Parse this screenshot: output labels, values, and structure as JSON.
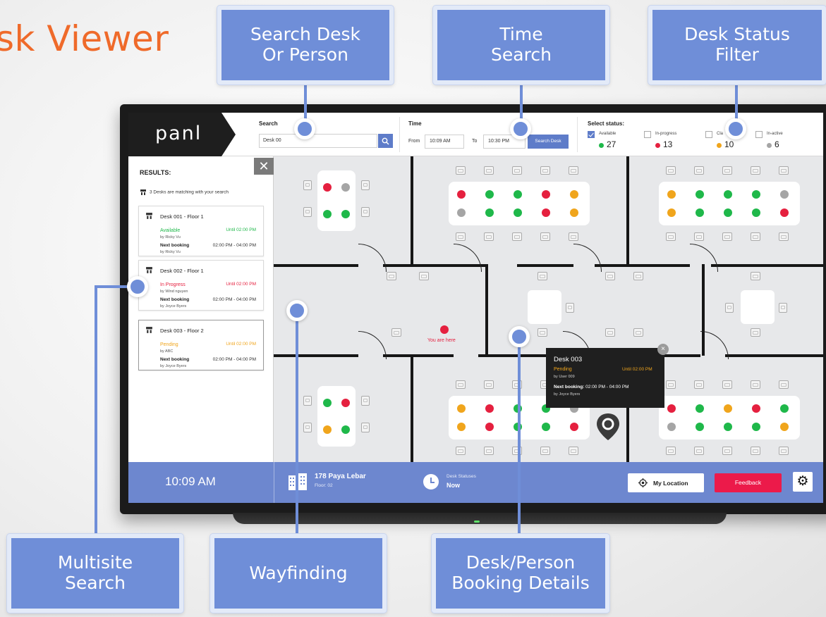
{
  "heading": "sk Viewer",
  "callouts": {
    "search": "Search Desk\nOr Person",
    "time": "Time\nSearch",
    "status_filter": "Desk Status\nFilter",
    "multisite": "Multisite\nSearch",
    "wayfinding": "Wayfinding",
    "booking_details": "Desk/Person\nBooking Details"
  },
  "app": {
    "logo": "panl",
    "search": {
      "label": "Search",
      "value": "Desk 00"
    },
    "time": {
      "label": "Time",
      "from_label": "From",
      "from_value": "10:09 AM",
      "to_label": "To",
      "to_value": "10:30 PM",
      "button": "Search Desk"
    },
    "status": {
      "label": "Select status:",
      "options": [
        {
          "name": "Available",
          "count": "27",
          "color": "#1fb84a",
          "checked": true
        },
        {
          "name": "In-progress",
          "count": "13",
          "color": "#e5203f",
          "checked": false
        },
        {
          "name": "Cla",
          "count": "10",
          "color": "#f0a51c",
          "checked": false
        },
        {
          "name": "In-active",
          "count": "6",
          "color": "#a5a5a5",
          "checked": false
        }
      ]
    }
  },
  "results": {
    "close": "✕",
    "title": "RESULTS:",
    "note": "3 Desks are matching with your search",
    "items": [
      {
        "title": "Desk 001 - Floor 1",
        "status": "Available",
        "status_color": "#1fb84a",
        "until": "Until 02:00 PM",
        "by": "by Ricky Vu",
        "next_label": "Next booking",
        "next_range": "02:00 PM - 04:00 PM",
        "next_by": "by Ricky Vu",
        "selected": false
      },
      {
        "title": "Desk 002 - Floor 1",
        "status": "In Progress",
        "status_color": "#e5203f",
        "until": "Until 02:00 PM",
        "by": "by Wind nguyen",
        "next_label": "Next booking",
        "next_range": "02:00 PM - 04:00 PM",
        "next_by": "by Joyce Byers",
        "selected": false
      },
      {
        "title": "Desk 003 - Floor 2",
        "status": "Pending",
        "status_color": "#f0a51c",
        "until": "Until 02:00 PM",
        "by": "by ABC",
        "next_label": "Next booking",
        "next_range": "02:00 PM - 04:00 PM",
        "next_by": "by Joyce Byers",
        "selected": true
      }
    ]
  },
  "map": {
    "you_are_here": "You are here",
    "popup": {
      "title": "Desk 003",
      "status": "Pending",
      "until": "Until 02:00 PM",
      "by": "by User 009",
      "next_label": "Next booking:",
      "next_range": "02:00 PM - 04:00 PM",
      "next_by": "by Joyce Byers",
      "close": "×"
    },
    "colors": {
      "green": "#1fb84a",
      "red": "#e5203f",
      "orange": "#f0a51c",
      "gray": "#a5a5a5"
    },
    "pods": [
      [
        "red",
        "gray",
        "green",
        "green"
      ],
      [
        "green",
        "red",
        "orange",
        "green"
      ]
    ],
    "banks": [
      [
        "red",
        "green",
        "green",
        "red",
        "orange",
        "gray",
        "green",
        "green",
        "red",
        "orange"
      ],
      [
        "orange",
        "green",
        "green",
        "green",
        "gray",
        "orange",
        "green",
        "green",
        "green",
        "red"
      ],
      [
        "orange",
        "red",
        "green",
        "green",
        "gray",
        "orange",
        "red",
        "green",
        "green",
        "red"
      ],
      [
        "red",
        "green",
        "orange",
        "red",
        "green",
        "gray",
        "green",
        "green",
        "green",
        "orange"
      ]
    ]
  },
  "bottom": {
    "clock": "10:09 AM",
    "location": "178 Paya Lebar",
    "floor": "Floor: 02",
    "desk_statuses_label": "Desk Statuses",
    "desk_statuses_value": "Now",
    "my_location": "My Location",
    "feedback": "Feedback",
    "settings_glyph": "⚙"
  }
}
